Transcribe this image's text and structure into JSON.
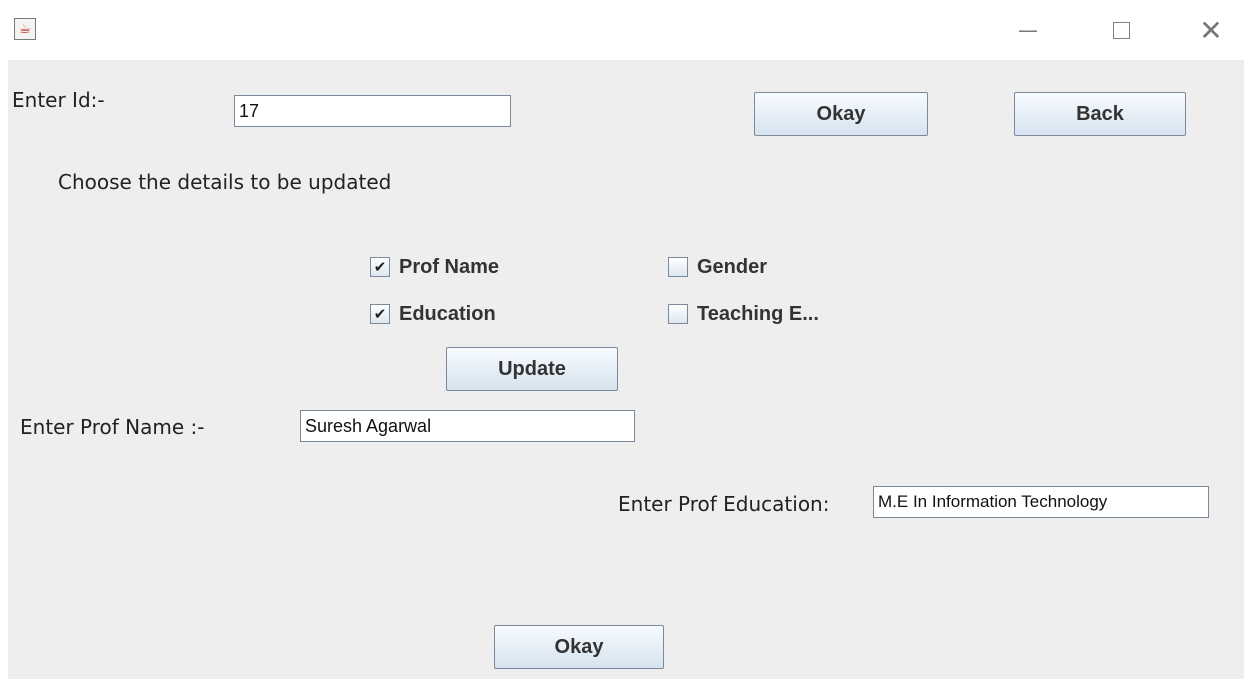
{
  "window": {
    "app_icon": "java-cup-icon",
    "minimize_glyph": "—",
    "close_glyph": "✕"
  },
  "form": {
    "id_label": "Enter Id:-",
    "id_value": "17",
    "okay_top_label": "Okay",
    "back_label": "Back",
    "choose_label": "Choose the details to be updated",
    "checkboxes": [
      {
        "label": "Prof Name",
        "checked": true
      },
      {
        "label": "Gender",
        "checked": false
      },
      {
        "label": "Education",
        "checked": true
      },
      {
        "label": "Teaching E...",
        "checked": false
      }
    ],
    "check_glyph": "✔",
    "update_label": "Update",
    "prof_name_label": "Enter Prof Name :-",
    "prof_name_value": "Suresh Agarwal",
    "prof_education_label": "Enter Prof Education:",
    "prof_education_value": "M.E In Information Technology",
    "okay_bottom_label": "Okay"
  }
}
